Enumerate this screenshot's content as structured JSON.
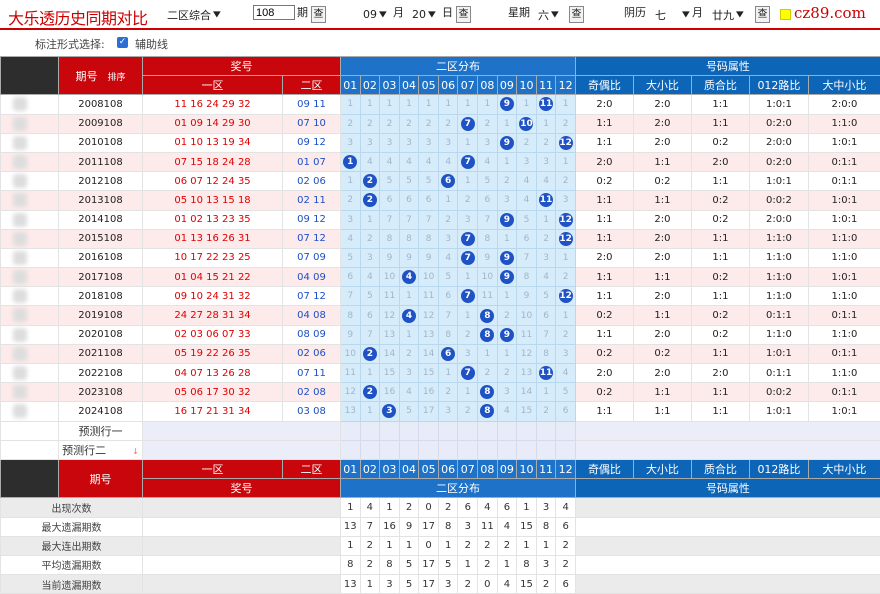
{
  "top": {
    "title": "大乐透历史同期对比",
    "zone_select": "二区综合",
    "period_input": "108",
    "period_suffix": "期",
    "q": "查",
    "month_val": "09",
    "month_lbl": "月",
    "day_val": "20",
    "day_lbl": "日",
    "week_lbl": "星期",
    "week_val": "六",
    "lunar_lbl": "阴历",
    "lunar_month": "七",
    "lunar_month_lbl": "月",
    "lunar_day": "廿九"
  },
  "logo": {
    "text": "cz89.com"
  },
  "options": {
    "label": "标注形式选择:",
    "checkbox_label": "辅助线"
  },
  "header": {
    "period": "期号",
    "sort": "排序",
    "prize": "奖号",
    "zone1": "一区",
    "zone2": "二区",
    "dist": "二区分布",
    "attrs": "号码属性",
    "cols": [
      "01",
      "02",
      "03",
      "04",
      "05",
      "06",
      "07",
      "08",
      "09",
      "10",
      "11",
      "12"
    ],
    "attr_cols": [
      "奇偶比",
      "大小比",
      "质合比",
      "012路比",
      "大中小比"
    ]
  },
  "rows": [
    {
      "period": "2008108",
      "front": "11 16 24 29 32",
      "back": "09 11",
      "miss": [
        "1",
        "1",
        "1",
        "1",
        "1",
        "1",
        "1",
        "1",
        "9",
        "1",
        "11",
        "1"
      ],
      "attrs": [
        "2:0",
        "2:0",
        "1:1",
        "1:0:1",
        "2:0:0"
      ]
    },
    {
      "period": "2009108",
      "front": "01 09 14 29 30",
      "back": "07 10",
      "miss": [
        "2",
        "2",
        "2",
        "2",
        "2",
        "2",
        "7",
        "2",
        "1",
        "10",
        "1",
        "2"
      ],
      "attrs": [
        "1:1",
        "2:0",
        "1:1",
        "0:2:0",
        "1:1:0"
      ]
    },
    {
      "period": "2010108",
      "front": "01 10 13 19 34",
      "back": "09 12",
      "miss": [
        "3",
        "3",
        "3",
        "3",
        "3",
        "3",
        "1",
        "3",
        "9",
        "2",
        "2",
        "12"
      ],
      "attrs": [
        "1:1",
        "2:0",
        "0:2",
        "2:0:0",
        "1:0:1"
      ]
    },
    {
      "period": "2011108",
      "front": "07 15 18 24 28",
      "back": "01 07",
      "miss": [
        "1",
        "4",
        "4",
        "4",
        "4",
        "4",
        "7",
        "4",
        "1",
        "3",
        "3",
        "1"
      ],
      "attrs": [
        "2:0",
        "1:1",
        "2:0",
        "0:2:0",
        "0:1:1"
      ]
    },
    {
      "period": "2012108",
      "front": "06 07 12 24 35",
      "back": "02 06",
      "miss": [
        "1",
        "2",
        "5",
        "5",
        "5",
        "6",
        "1",
        "5",
        "2",
        "4",
        "4",
        "2"
      ],
      "attrs": [
        "0:2",
        "0:2",
        "1:1",
        "1:0:1",
        "0:1:1"
      ]
    },
    {
      "period": "2013108",
      "front": "05 10 13 15 18",
      "back": "02 11",
      "miss": [
        "2",
        "2",
        "6",
        "6",
        "6",
        "1",
        "2",
        "6",
        "3",
        "4",
        "11",
        "3"
      ],
      "attrs": [
        "1:1",
        "1:1",
        "0:2",
        "0:0:2",
        "1:0:1"
      ]
    },
    {
      "period": "2014108",
      "front": "01 02 13 23 35",
      "back": "09 12",
      "miss": [
        "3",
        "1",
        "7",
        "7",
        "7",
        "2",
        "3",
        "7",
        "9",
        "5",
        "1",
        "12"
      ],
      "attrs": [
        "1:1",
        "2:0",
        "0:2",
        "2:0:0",
        "1:0:1"
      ]
    },
    {
      "period": "2015108",
      "front": "01 13 16 26 31",
      "back": "07 12",
      "miss": [
        "4",
        "2",
        "8",
        "8",
        "8",
        "3",
        "7",
        "8",
        "1",
        "6",
        "2",
        "12"
      ],
      "attrs": [
        "1:1",
        "2:0",
        "1:1",
        "1:1:0",
        "1:1:0"
      ]
    },
    {
      "period": "2016108",
      "front": "10 17 22 23 25",
      "back": "07 09",
      "miss": [
        "5",
        "3",
        "9",
        "9",
        "9",
        "4",
        "7",
        "9",
        "9",
        "7",
        "3",
        "1"
      ],
      "attrs": [
        "2:0",
        "2:0",
        "1:1",
        "1:1:0",
        "1:1:0"
      ]
    },
    {
      "period": "2017108",
      "front": "01 04 15 21 22",
      "back": "04 09",
      "miss": [
        "6",
        "4",
        "10",
        "4",
        "10",
        "5",
        "1",
        "10",
        "9",
        "8",
        "4",
        "2"
      ],
      "attrs": [
        "1:1",
        "1:1",
        "0:2",
        "1:1:0",
        "1:0:1"
      ]
    },
    {
      "period": "2018108",
      "front": "09 10 24 31 32",
      "back": "07 12",
      "miss": [
        "7",
        "5",
        "11",
        "1",
        "11",
        "6",
        "7",
        "11",
        "1",
        "9",
        "5",
        "12"
      ],
      "attrs": [
        "1:1",
        "2:0",
        "1:1",
        "1:1:0",
        "1:1:0"
      ]
    },
    {
      "period": "2019108",
      "front": "24 27 28 31 34",
      "back": "04 08",
      "miss": [
        "8",
        "6",
        "12",
        "4",
        "12",
        "7",
        "1",
        "8",
        "2",
        "10",
        "6",
        "1"
      ],
      "attrs": [
        "0:2",
        "1:1",
        "0:2",
        "0:1:1",
        "0:1:1"
      ]
    },
    {
      "period": "2020108",
      "front": "02 03 06 07 33",
      "back": "08 09",
      "miss": [
        "9",
        "7",
        "13",
        "1",
        "13",
        "8",
        "2",
        "8",
        "9",
        "11",
        "7",
        "2"
      ],
      "attrs": [
        "1:1",
        "2:0",
        "0:2",
        "1:1:0",
        "1:1:0"
      ]
    },
    {
      "period": "2021108",
      "front": "05 19 22 26 35",
      "back": "02 06",
      "miss": [
        "10",
        "2",
        "14",
        "2",
        "14",
        "6",
        "3",
        "1",
        "1",
        "12",
        "8",
        "3"
      ],
      "attrs": [
        "0:2",
        "0:2",
        "1:1",
        "1:0:1",
        "0:1:1"
      ]
    },
    {
      "period": "2022108",
      "front": "04 07 13 26 28",
      "back": "07 11",
      "miss": [
        "11",
        "1",
        "15",
        "3",
        "15",
        "1",
        "7",
        "2",
        "2",
        "13",
        "11",
        "4"
      ],
      "attrs": [
        "2:0",
        "2:0",
        "2:0",
        "0:1:1",
        "1:1:0"
      ]
    },
    {
      "period": "2023108",
      "front": "05 06 17 30 32",
      "back": "02 08",
      "miss": [
        "12",
        "2",
        "16",
        "4",
        "16",
        "2",
        "1",
        "8",
        "3",
        "14",
        "1",
        "5"
      ],
      "attrs": [
        "0:2",
        "1:1",
        "1:1",
        "0:0:2",
        "0:1:1"
      ]
    },
    {
      "period": "2024108",
      "front": "16 17 21 31 34",
      "back": "03 08",
      "miss": [
        "13",
        "1",
        "3",
        "5",
        "17",
        "3",
        "2",
        "8",
        "4",
        "15",
        "2",
        "6"
      ],
      "attrs": [
        "1:1",
        "1:1",
        "1:1",
        "1:0:1",
        "1:0:1"
      ]
    }
  ],
  "hits": [
    [
      "09",
      "11"
    ],
    [
      "07",
      "10"
    ],
    [
      "09",
      "12"
    ],
    [
      "01",
      "07"
    ],
    [
      "02",
      "06"
    ],
    [
      "02",
      "11"
    ],
    [
      "09",
      "12"
    ],
    [
      "07",
      "12"
    ],
    [
      "07",
      "09"
    ],
    [
      "04",
      "09"
    ],
    [
      "07",
      "12"
    ],
    [
      "04",
      "08"
    ],
    [
      "08",
      "09"
    ],
    [
      "02",
      "06"
    ],
    [
      "07",
      "11"
    ],
    [
      "02",
      "08"
    ],
    [
      "03",
      "08"
    ]
  ],
  "predict": {
    "row1": "预测行一",
    "row2": "预测行二",
    "arrow": "↓"
  },
  "stats": {
    "labels": [
      "出现次数",
      "最大遗漏期数",
      "最大连出期数",
      "平均遗漏期数",
      "当前遗漏期数"
    ],
    "values": [
      [
        "1",
        "4",
        "1",
        "2",
        "0",
        "2",
        "6",
        "4",
        "6",
        "1",
        "3",
        "4"
      ],
      [
        "13",
        "7",
        "16",
        "9",
        "17",
        "8",
        "3",
        "11",
        "4",
        "15",
        "8",
        "6"
      ],
      [
        "1",
        "2",
        "1",
        "1",
        "0",
        "1",
        "2",
        "2",
        "2",
        "1",
        "1",
        "2"
      ],
      [
        "8",
        "2",
        "8",
        "5",
        "17",
        "5",
        "1",
        "2",
        "1",
        "8",
        "3",
        "2"
      ],
      [
        "13",
        "1",
        "3",
        "5",
        "17",
        "3",
        "2",
        "0",
        "4",
        "15",
        "2",
        "6"
      ]
    ]
  }
}
